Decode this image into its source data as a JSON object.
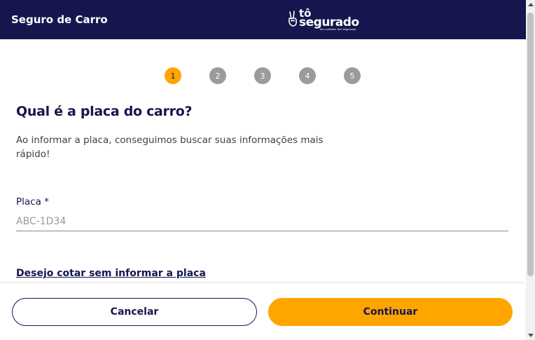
{
  "header": {
    "title": "Seguro de Carro",
    "logo": {
      "top": "tô",
      "main": "segurado",
      "tagline": "tem coisinha, tem segurança",
      "icon": "peace-hand-icon"
    }
  },
  "stepper": {
    "steps": [
      "1",
      "2",
      "3",
      "4",
      "5"
    ],
    "current": 1
  },
  "main": {
    "heading": "Qual é a placa do carro?",
    "description": "Ao informar a placa, conseguimos buscar suas informações mais rápido!",
    "field": {
      "label": "Placa *",
      "placeholder": "ABC-1D34",
      "value": ""
    },
    "skip_link": "Desejo cotar sem informar a placa"
  },
  "footer": {
    "cancel_label": "Cancelar",
    "continue_label": "Continuar"
  },
  "colors": {
    "header_bg": "#14164d",
    "accent": "#ffa500",
    "step_inactive": "#9b9b9b"
  }
}
